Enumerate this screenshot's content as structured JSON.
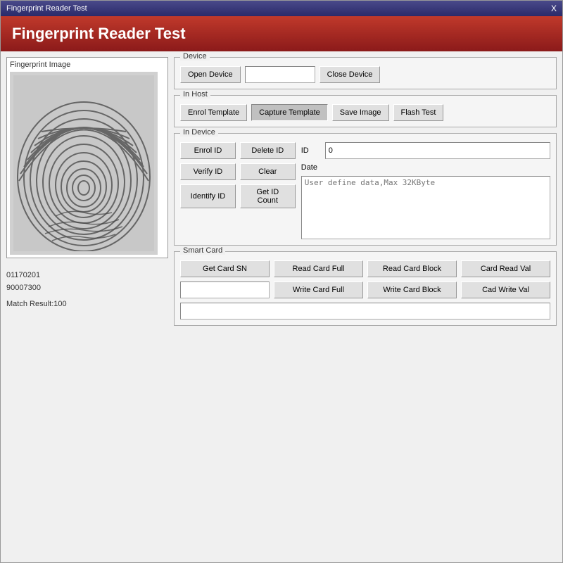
{
  "window": {
    "title": "Fingerprint Reader Test",
    "close_label": "X"
  },
  "header": {
    "title": "Fingerprint Reader Test"
  },
  "left": {
    "fingerprint_section_label": "Fingerprint Image",
    "serial1": "01170201",
    "serial2": "90007300",
    "match_result": "Match Result:100"
  },
  "device": {
    "group_label": "Device",
    "open_btn": "Open Device",
    "close_btn": "Close Device",
    "input_value": ""
  },
  "in_host": {
    "group_label": "In Host",
    "enrol_btn": "Enrol Template",
    "capture_btn": "Capture Template",
    "save_btn": "Save Image",
    "flash_btn": "Flash Test"
  },
  "in_device": {
    "group_label": "In Device",
    "enrol_btn": "Enrol ID",
    "delete_btn": "Delete ID",
    "verify_btn": "Verify ID",
    "clear_btn": "Clear",
    "identify_btn": "Identify ID",
    "get_count_btn": "Get ID Count",
    "id_label": "ID",
    "id_value": "0",
    "date_label": "Date",
    "data_placeholder": "User define data,Max 32KByte"
  },
  "smart_card": {
    "group_label": "Smart Card",
    "get_sn_btn": "Get Card SN",
    "read_full_btn": "Read Card Full",
    "read_block_btn": "Read Card Block",
    "card_read_val_btn": "Card Read Val",
    "card_input_value": "",
    "write_full_btn": "Write Card Full",
    "write_block_btn": "Write Card Block",
    "cad_write_val_btn": "Cad Write Val",
    "bottom_input_value": ""
  }
}
